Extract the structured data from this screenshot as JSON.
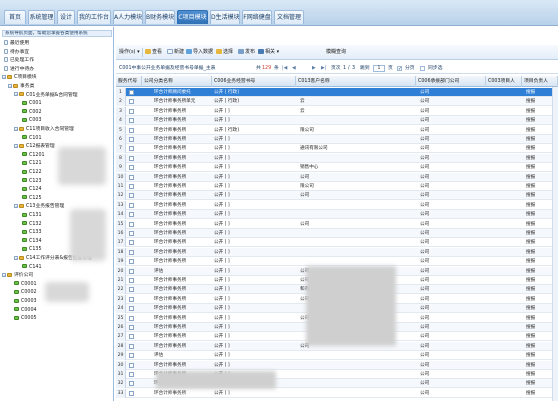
{
  "topnav": {
    "tabs": [
      {
        "label": "首页"
      },
      {
        "label": "系统管理"
      },
      {
        "label": "设计"
      },
      {
        "label": "我的工作台"
      },
      {
        "label": "A人力模块"
      },
      {
        "label": "B财务模块"
      },
      {
        "label": "C项目模块"
      },
      {
        "label": "D生活模块"
      },
      {
        "label": "F网络健盘"
      },
      {
        "label": "文档管理"
      }
    ]
  },
  "sidebar": {
    "tip": "系统导航页面，帮助您掌握各类使用系统",
    "nodes": [
      {
        "label": "最近使用",
        "icon": "page"
      },
      {
        "label": "待办事宜",
        "icon": "page"
      },
      {
        "label": "已处理工作",
        "icon": "page"
      },
      {
        "label": "进行中待办",
        "icon": "page"
      },
      {
        "label": "C项目模块",
        "icon": "folder",
        "toggle": "-"
      },
      {
        "label": "事务类",
        "icon": "folder",
        "toggle": "-"
      },
      {
        "label": "C01业务单据&合同管理",
        "icon": "folder",
        "toggle": "-"
      },
      {
        "label": "C001",
        "icon": "green"
      },
      {
        "label": "C002",
        "icon": "green"
      },
      {
        "label": "C003",
        "icon": "green"
      },
      {
        "label": "C11项目收入合同管理",
        "icon": "folder",
        "toggle": "-"
      },
      {
        "label": "C101",
        "icon": "green"
      },
      {
        "label": "C12报表管理",
        "icon": "folder",
        "toggle": "-"
      },
      {
        "label": "C1201",
        "icon": "green"
      },
      {
        "label": "C121",
        "icon": "green"
      },
      {
        "label": "C122",
        "icon": "green"
      },
      {
        "label": "C123",
        "icon": "green"
      },
      {
        "label": "C124",
        "icon": "green"
      },
      {
        "label": "C125",
        "icon": "green"
      },
      {
        "label": "C13业务报告管理",
        "icon": "folder",
        "toggle": "-"
      },
      {
        "label": "C131",
        "icon": "green"
      },
      {
        "label": "C132",
        "icon": "green"
      },
      {
        "label": "C133",
        "icon": "green"
      },
      {
        "label": "C134",
        "icon": "green"
      },
      {
        "label": "C135",
        "icon": "green"
      },
      {
        "label": "C14工作评分表&报告回复管理",
        "icon": "folder",
        "toggle": "-"
      },
      {
        "label": "C141",
        "icon": "green"
      },
      {
        "label": "评价公司",
        "icon": "folder",
        "toggle": "-"
      },
      {
        "label": "C0001",
        "icon": "green"
      },
      {
        "label": "C0002",
        "icon": "green"
      },
      {
        "label": "C0003",
        "icon": "green"
      },
      {
        "label": "C0004",
        "icon": "green"
      },
      {
        "label": "C0005",
        "icon": "green"
      }
    ]
  },
  "toolbar": {
    "operate": "操作(s) ▾",
    "view": "查看",
    "new": "新建",
    "import": "导入数据",
    "choose": "选择",
    "send": "发布",
    "related": "相关 ▾",
    "fuzzy": "模糊查询"
  },
  "infobar": {
    "title": "C001中事公开业务单据及经营书号单据_主表",
    "total_prefix": "共",
    "total_count": "129",
    "total_suffix": "条",
    "page_prefix": "页次",
    "page_current": "1",
    "page_sep": "/",
    "page_total": "3",
    "jump": "跳到",
    "jump_page": "1",
    "page_suffix": "页",
    "paging": "分页",
    "sync": "同步选"
  },
  "grid": {
    "columns": [
      "服务代号",
      "公司分类名称",
      "C006业务经营书号",
      "C013客户名称",
      "C006承接部门公司",
      "C003项目人",
      "项目负责人"
    ],
    "rows": [
      {
        "n": "1",
        "a": "环合计师顾问委托",
        "b": "公开 [ 行政]",
        "c": "",
        "d": "公司",
        "e": "",
        "f": "搜报"
      },
      {
        "n": "2",
        "a": "环合计师事务所单元",
        "b": "公开 [ 行政]",
        "c": "云",
        "d": "公司",
        "e": "",
        "f": "搜报"
      },
      {
        "n": "3",
        "a": "环合计师事务所",
        "b": "公开 [ ]",
        "c": "云",
        "d": "公司",
        "e": "",
        "f": "搜报"
      },
      {
        "n": "4",
        "a": "环合计师事务所",
        "b": "公开 [ ]",
        "c": "",
        "d": "公司",
        "e": "",
        "f": "搜报"
      },
      {
        "n": "5",
        "a": "环合计师事务所",
        "b": "公开 [ 行政]",
        "c": "限公司",
        "d": "公司",
        "e": "",
        "f": "搜报"
      },
      {
        "n": "6",
        "a": "环合计师事务所",
        "b": "公开 [ ]",
        "c": "",
        "d": "公司",
        "e": "",
        "f": "搜报"
      },
      {
        "n": "7",
        "a": "环合计师事务所",
        "b": "公开 [ ]",
        "c": "通讯有限公司",
        "d": "公司",
        "e": "",
        "f": "搜报"
      },
      {
        "n": "8",
        "a": "环合计师事务所",
        "b": "公开 [ ]",
        "c": "",
        "d": "公司",
        "e": "",
        "f": "搜报"
      },
      {
        "n": "9",
        "a": "环合计师事务所",
        "b": "公开 [ ]",
        "c": "销售中心",
        "d": "公司",
        "e": "",
        "f": "搜报"
      },
      {
        "n": "10",
        "a": "环合计师事务所",
        "b": "公开 [ ]",
        "c": "公司",
        "d": "公司",
        "e": "",
        "f": "搜报"
      },
      {
        "n": "11",
        "a": "环合计师事务所",
        "b": "公开 [ ]",
        "c": "限公司",
        "d": "公司",
        "e": "",
        "f": "搜报"
      },
      {
        "n": "12",
        "a": "环合计师事务所",
        "b": "公开 [ ]",
        "c": "公司",
        "d": "公司",
        "e": "",
        "f": "搜报"
      },
      {
        "n": "13",
        "a": "环合计师事务所",
        "b": "公开 [ ]",
        "c": "",
        "d": "公司",
        "e": "",
        "f": "搜报"
      },
      {
        "n": "14",
        "a": "环合计师事务所",
        "b": "公开 [ ]",
        "c": "",
        "d": "公司",
        "e": "",
        "f": "搜报"
      },
      {
        "n": "15",
        "a": "环合计师事务所",
        "b": "公开 [ ]",
        "c": "公司",
        "d": "公司",
        "e": "",
        "f": "搜报"
      },
      {
        "n": "16",
        "a": "环合计师事务所",
        "b": "公开 [ ]",
        "c": "",
        "d": "公司",
        "e": "",
        "f": "搜报"
      },
      {
        "n": "17",
        "a": "环合计师事务所",
        "b": "公开 [ ]",
        "c": "",
        "d": "公司",
        "e": "",
        "f": "搜报"
      },
      {
        "n": "18",
        "a": "环合计师事务所",
        "b": "公开 [ ]",
        "c": "",
        "d": "公司",
        "e": "",
        "f": "搜报"
      },
      {
        "n": "19",
        "a": "环合计师事务所",
        "b": "公开 [ ]",
        "c": "",
        "d": "公司",
        "e": "",
        "f": "搜报"
      },
      {
        "n": "20",
        "a": "评估",
        "b": "公开 [ ]",
        "c": "公司",
        "d": "公司",
        "e": "",
        "f": "搜报"
      },
      {
        "n": "21",
        "a": "环合计师事务所",
        "b": "公开 [ ]",
        "c": "公司",
        "d": "公司",
        "e": "",
        "f": "搜报"
      },
      {
        "n": "22",
        "a": "环合计师事务所",
        "b": "公开 [ ]",
        "c": "和有限公司",
        "d": "公司",
        "e": "",
        "f": "搜报"
      },
      {
        "n": "23",
        "a": "环合计师事务所",
        "b": "公开 [ ]",
        "c": "公司",
        "d": "公司",
        "e": "",
        "f": "搜报"
      },
      {
        "n": "24",
        "a": "环合计师事务所",
        "b": "公开 [ ]",
        "c": "",
        "d": "公司",
        "e": "",
        "f": "搜报"
      },
      {
        "n": "25",
        "a": "环合计师事务所",
        "b": "公开 [ ]",
        "c": "公司",
        "d": "公司",
        "e": "",
        "f": "搜报"
      },
      {
        "n": "26",
        "a": "环合计师事务所",
        "b": "公开 [ ]",
        "c": "",
        "d": "公司",
        "e": "",
        "f": "搜报"
      },
      {
        "n": "27",
        "a": "环合计师事务所",
        "b": "公开 [ ]",
        "c": "",
        "d": "公司",
        "e": "",
        "f": "搜报"
      },
      {
        "n": "28",
        "a": "环合计师事务所",
        "b": "公开 [ ]",
        "c": "公司",
        "d": "公司",
        "e": "",
        "f": "搜报"
      },
      {
        "n": "29",
        "a": "评估",
        "b": "公开 [ ]",
        "c": "",
        "d": "公司",
        "e": "",
        "f": "搜报"
      },
      {
        "n": "30",
        "a": "环合计师事务所",
        "b": "公开 [ ]",
        "c": "",
        "d": "公司",
        "e": "",
        "f": "搜报"
      },
      {
        "n": "31",
        "a": "环合计师事务所",
        "b": "公开 [ ]",
        "c": "",
        "d": "公司",
        "e": "",
        "f": "搜报"
      },
      {
        "n": "32",
        "a": "环合计师事务所",
        "b": "公开 [ ]",
        "c": "",
        "d": "公司",
        "e": "",
        "f": "搜报"
      },
      {
        "n": "33",
        "a": "环合计师事务所",
        "b": "公开 [ ]",
        "c": "",
        "d": "公司",
        "e": "",
        "f": "搜报"
      }
    ]
  },
  "colors": {
    "accent": "#2f6fb4",
    "selected_row": "#2f7fd6",
    "header": "#d7e4f2"
  }
}
